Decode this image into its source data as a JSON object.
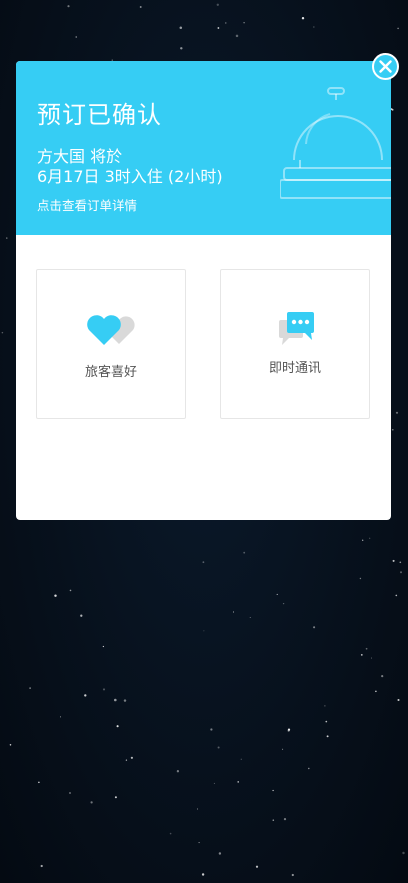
{
  "confirmation": {
    "title": "预订已确认",
    "guest_line": "方大国 将於",
    "checkin_line": "6月17日 3时入住 (2小时)",
    "details_link": "点击查看订单详情"
  },
  "actions": {
    "preferences_label": "旅客喜好",
    "chat_label": "即时通讯"
  },
  "icons": {
    "close": "close-icon",
    "bell": "service-bell-icon",
    "preferences": "hearts-icon",
    "chat": "chat-bubbles-icon"
  },
  "colors": {
    "accent": "#36cdf4",
    "background": "#07111d",
    "card_border": "#e6e6e6",
    "label_text": "#555555"
  }
}
